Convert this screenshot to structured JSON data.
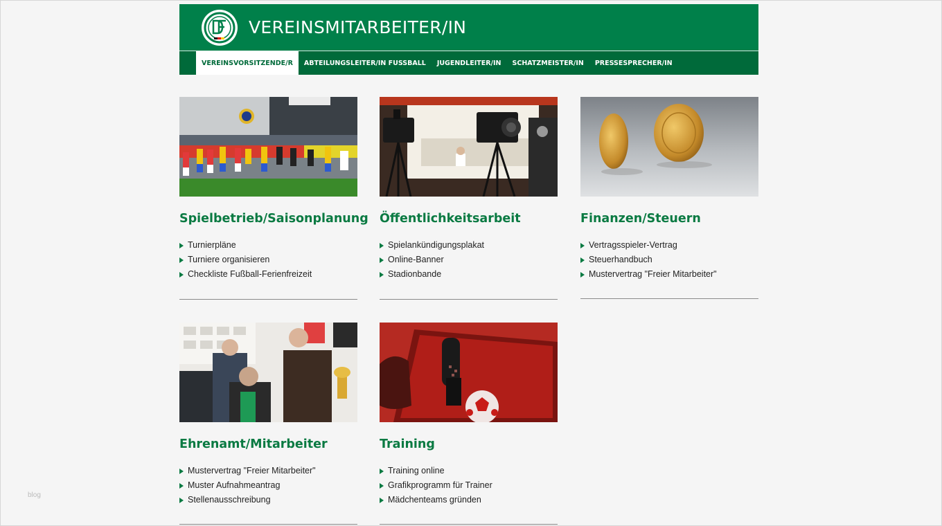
{
  "header": {
    "title": "VEREINSMITARBEITER/IN"
  },
  "nav": [
    {
      "label": "VEREINSVORSITZENDE/R",
      "active": true
    },
    {
      "label": "ABTEILUNGSLEITER/IN FUSSBALL",
      "active": false
    },
    {
      "label": "JUGENDLEITER/IN",
      "active": false
    },
    {
      "label": "SCHATZMEISTER/IN",
      "active": false
    },
    {
      "label": "PRESSESPRECHER/IN",
      "active": false
    }
  ],
  "cards": [
    {
      "title": "Spielbetrieb/Saisonplanung",
      "image": "football-match-photo",
      "links": [
        "Turnierpläne",
        "Turniere organisieren",
        "Checkliste Fußball-Ferienfreizeit"
      ]
    },
    {
      "title": "Öffentlichkeitsarbeit",
      "image": "tv-cameras-press-photo",
      "links": [
        "Spielankündigungsplakat",
        "Online-Banner",
        "Stadionbande"
      ]
    },
    {
      "title": "Finanzen/Steuern",
      "image": "coins-photo",
      "links": [
        "Vertragsspieler-Vertrag",
        "Steuerhandbuch",
        "Mustervertrag \"Freier Mitarbeiter\""
      ]
    },
    {
      "title": "Ehrenamt/Mitarbeiter",
      "image": "office-team-photo",
      "links": [
        "Mustervertrag \"Freier Mitarbeiter\"",
        "Muster Aufnahmeantrag",
        "Stellenausschreibung"
      ]
    },
    {
      "title": "Training",
      "image": "tablet-football-photo",
      "links": [
        "Training online",
        "Grafikprogramm für Trainer",
        "Mädchenteams gründen"
      ]
    }
  ],
  "watermark": "blog",
  "colors": {
    "brand_green": "#00804a",
    "nav_green": "#006a3a",
    "heading_green": "#0a7a42"
  }
}
